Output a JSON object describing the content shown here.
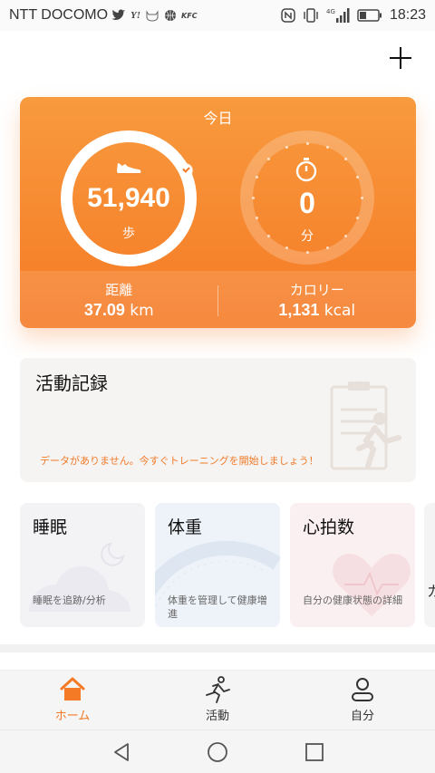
{
  "status_bar": {
    "carrier": "NTT DOCOMO",
    "time": "18:23",
    "icons": [
      "twitter-icon",
      "yahoo-icon",
      "cat-icon",
      "basketball-icon",
      "kfc-icon",
      "nfc-icon",
      "vibrate-icon",
      "4g-signal-icon",
      "battery-icon"
    ]
  },
  "header": {
    "add_icon": "plus-icon"
  },
  "summary": {
    "title": "今日",
    "steps": {
      "value": "51,940",
      "unit": "歩",
      "goal_reached": true
    },
    "active_time": {
      "value": "0",
      "unit": "分"
    },
    "distance": {
      "label": "距離",
      "value": "37.09",
      "unit": "km"
    },
    "calories": {
      "label": "カロリー",
      "value": "1,131",
      "unit": "kcal"
    },
    "accent": "#f57a25"
  },
  "activity_record": {
    "title": "活動記録",
    "message": "データがありません。今すぐトレーニングを開始しましょう！"
  },
  "cards": [
    {
      "title": "睡眠",
      "description": "睡眠を追跡/分析"
    },
    {
      "title": "体重",
      "description": "体重を管理して健康増進"
    },
    {
      "title": "心拍数",
      "description": "自分の健康状態の詳細"
    },
    {
      "title": "カ"
    }
  ],
  "bottom_nav": [
    {
      "label": "ホーム",
      "icon": "home-icon",
      "active": true
    },
    {
      "label": "活動",
      "icon": "running-icon",
      "active": false
    },
    {
      "label": "自分",
      "icon": "person-icon",
      "active": false
    }
  ],
  "system_nav": [
    "back-icon",
    "home-circle-icon",
    "recents-icon"
  ]
}
